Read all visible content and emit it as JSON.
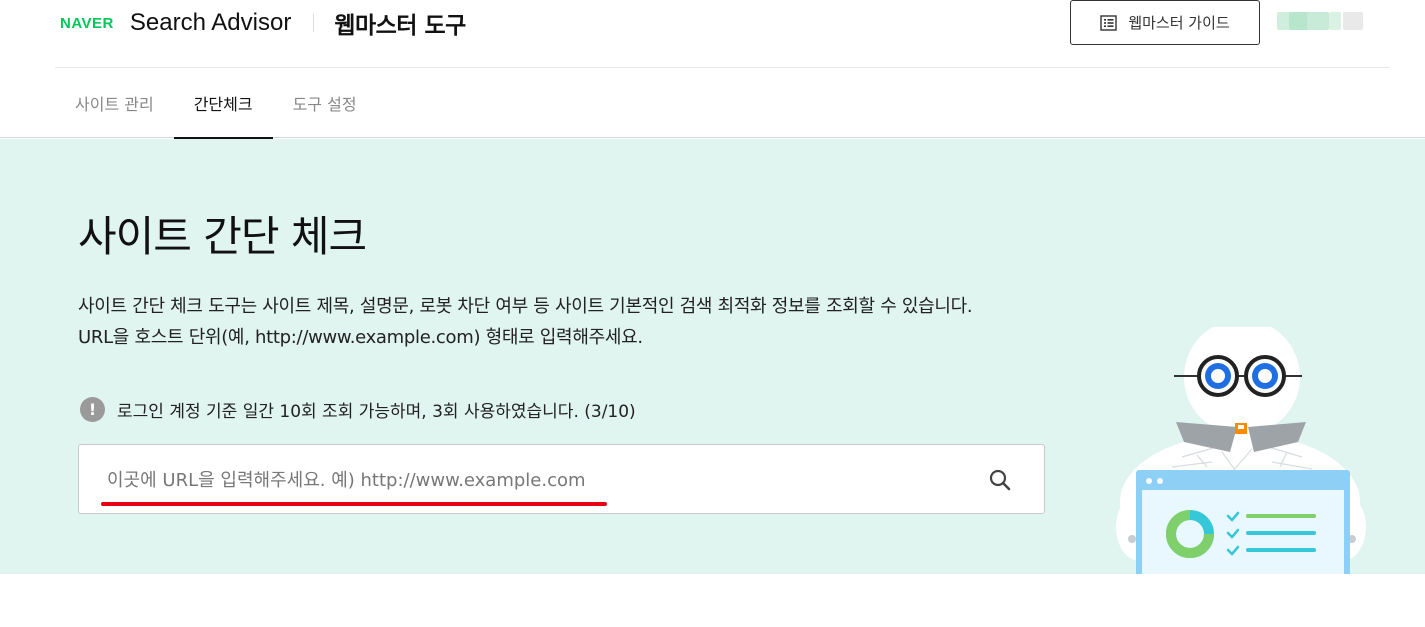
{
  "header": {
    "naver_logo": "NAVER",
    "product": "Search Advisor",
    "tool_title": "웹마스터 도구",
    "guide_button": "웹마스터 가이드",
    "guide_icon": "document-list-icon"
  },
  "tabs": [
    {
      "label": "사이트 관리",
      "active": false
    },
    {
      "label": "간단체크",
      "active": true
    },
    {
      "label": "도구 설정",
      "active": false
    }
  ],
  "hero": {
    "title": "사이트 간단 체크",
    "description_line1": "사이트 간단 체크 도구는 사이트 제목, 설명문, 로봇 차단 여부 등 사이트 기본적인 검색 최적화 정보를 조회할 수 있습니다.",
    "description_line2": "URL을 호스트 단위(예, http://www.example.com) 형태로 입력해주세요.",
    "notice": "로그인 계정 기준 일간 10회 조회 가능하며, 3회 사용하였습니다. (3/10)",
    "notice_icon": "!",
    "usage": {
      "used": 3,
      "limit": 10
    }
  },
  "search": {
    "placeholder": "이곳에 URL을 입력해주세요. 예) http://www.example.com",
    "value": "",
    "icon": "search-icon"
  },
  "colors": {
    "brand_green": "#03c75a",
    "hero_bg": "#e0f4f0",
    "underline_red": "#e60012"
  }
}
